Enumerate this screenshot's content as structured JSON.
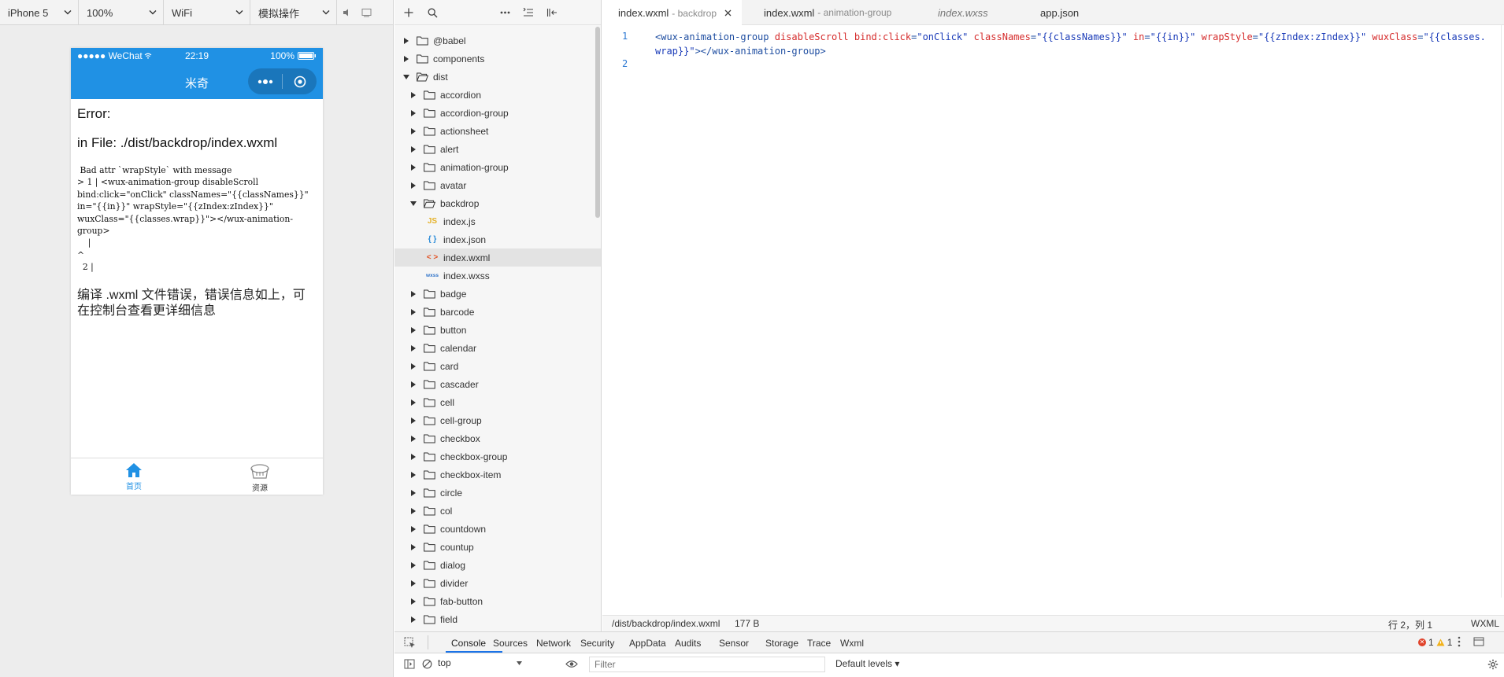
{
  "simulator": {
    "toolbar": {
      "device": "iPhone 5",
      "zoom": "100%",
      "network": "WiFi",
      "operation": "模拟操作"
    },
    "status_bar": {
      "carrier": "●●●●● WeChat",
      "time": "22:19",
      "battery": "100%"
    },
    "nav_title": "米奇",
    "error": {
      "title": "Error:",
      "file": "in File: ./dist/backdrop/index.wxml",
      "message": " Bad attr `wrapStyle` with message\n> 1 | <wux-animation-group disableScroll bind:click=\"onClick\" classNames=\"{{classNames}}\" in=\"{{in}}\" wrapStyle=\"{{zIndex:zIndex}}\" wuxClass=\"{{classes.wrap}}\"></wux-animation-group>\n    |\n^\n  2 |",
      "hint": "编译 .wxml 文件错误，错误信息如上，可在控制台查看更详细信息"
    },
    "tabbar": {
      "items": [
        {
          "label": "首页",
          "icon": "home-icon"
        },
        {
          "label": "资源",
          "icon": "basket-icon"
        }
      ]
    }
  },
  "file_tree": {
    "rows": [
      {
        "label": "@babel",
        "type": "folder",
        "expanded": false,
        "level": 0
      },
      {
        "label": "components",
        "type": "folder",
        "expanded": false,
        "level": 0
      },
      {
        "label": "dist",
        "type": "folder",
        "expanded": true,
        "level": 0
      },
      {
        "label": "accordion",
        "type": "folder",
        "expanded": false,
        "level": 1
      },
      {
        "label": "accordion-group",
        "type": "folder",
        "expanded": false,
        "level": 1
      },
      {
        "label": "actionsheet",
        "type": "folder",
        "expanded": false,
        "level": 1
      },
      {
        "label": "alert",
        "type": "folder",
        "expanded": false,
        "level": 1
      },
      {
        "label": "animation-group",
        "type": "folder",
        "expanded": false,
        "level": 1
      },
      {
        "label": "avatar",
        "type": "folder",
        "expanded": false,
        "level": 1
      },
      {
        "label": "backdrop",
        "type": "folder",
        "expanded": true,
        "level": 1
      },
      {
        "label": "index.js",
        "type": "js",
        "level": 2
      },
      {
        "label": "index.json",
        "type": "json",
        "level": 2
      },
      {
        "label": "index.wxml",
        "type": "wxml",
        "level": 2,
        "selected": true
      },
      {
        "label": "index.wxss",
        "type": "wxss",
        "level": 2
      },
      {
        "label": "badge",
        "type": "folder",
        "expanded": false,
        "level": 1
      },
      {
        "label": "barcode",
        "type": "folder",
        "expanded": false,
        "level": 1
      },
      {
        "label": "button",
        "type": "folder",
        "expanded": false,
        "level": 1
      },
      {
        "label": "calendar",
        "type": "folder",
        "expanded": false,
        "level": 1
      },
      {
        "label": "card",
        "type": "folder",
        "expanded": false,
        "level": 1
      },
      {
        "label": "cascader",
        "type": "folder",
        "expanded": false,
        "level": 1
      },
      {
        "label": "cell",
        "type": "folder",
        "expanded": false,
        "level": 1
      },
      {
        "label": "cell-group",
        "type": "folder",
        "expanded": false,
        "level": 1
      },
      {
        "label": "checkbox",
        "type": "folder",
        "expanded": false,
        "level": 1
      },
      {
        "label": "checkbox-group",
        "type": "folder",
        "expanded": false,
        "level": 1
      },
      {
        "label": "checkbox-item",
        "type": "folder",
        "expanded": false,
        "level": 1
      },
      {
        "label": "circle",
        "type": "folder",
        "expanded": false,
        "level": 1
      },
      {
        "label": "col",
        "type": "folder",
        "expanded": false,
        "level": 1
      },
      {
        "label": "countdown",
        "type": "folder",
        "expanded": false,
        "level": 1
      },
      {
        "label": "countup",
        "type": "folder",
        "expanded": false,
        "level": 1
      },
      {
        "label": "dialog",
        "type": "folder",
        "expanded": false,
        "level": 1
      },
      {
        "label": "divider",
        "type": "folder",
        "expanded": false,
        "level": 1
      },
      {
        "label": "fab-button",
        "type": "folder",
        "expanded": false,
        "level": 1
      },
      {
        "label": "field",
        "type": "folder",
        "expanded": false,
        "level": 1
      }
    ],
    "file_icon_text": {
      "js": "JS",
      "json": "{ }",
      "wxml": "< >",
      "wxss": "wxss"
    }
  },
  "editor": {
    "tabs": [
      {
        "name": "index.wxml",
        "sub": "- backdrop",
        "active": true,
        "closable": true
      },
      {
        "name": "index.wxml",
        "sub": "- animation-group",
        "active": false
      },
      {
        "name": "index.wxss",
        "sub": "",
        "active": false,
        "italic": true
      },
      {
        "name": "app.json",
        "sub": "",
        "active": false
      }
    ],
    "lines": [
      {
        "number": "1",
        "tokens": [
          {
            "t": "<wux-animation-group ",
            "c": "tag"
          },
          {
            "t": "disableScroll ",
            "c": "attr"
          },
          {
            "t": "bind:click",
            "c": "attr"
          },
          {
            "t": "=",
            "c": "tag"
          },
          {
            "t": "\"onClick\" ",
            "c": "str"
          },
          {
            "t": "classNames",
            "c": "attr"
          },
          {
            "t": "=",
            "c": "tag"
          },
          {
            "t": "\"{{classNames}}\" ",
            "c": "str"
          },
          {
            "t": "in",
            "c": "attr"
          },
          {
            "t": "=",
            "c": "tag"
          },
          {
            "t": "\"{{in}}\" ",
            "c": "str"
          },
          {
            "t": "wrapStyle",
            "c": "attr"
          },
          {
            "t": "=",
            "c": "tag"
          },
          {
            "t": "\"{{zIndex:zIndex}}\" ",
            "c": "str"
          },
          {
            "t": "wuxClass",
            "c": "attr"
          },
          {
            "t": "=",
            "c": "tag"
          },
          {
            "t": "\"{{classes.wrap}}\"",
            "c": "str"
          },
          {
            "t": "></wux-animation-group>",
            "c": "tag"
          }
        ]
      },
      {
        "number": "2",
        "tokens": []
      }
    ],
    "status": {
      "path": "/dist/backdrop/index.wxml",
      "size": "177 B",
      "position": "行 2，列 1",
      "language": "WXML"
    }
  },
  "devtools": {
    "tabs": [
      "Console",
      "Sources",
      "Network",
      "Security",
      "AppData",
      "Audits",
      "Sensor",
      "Storage",
      "Trace",
      "Wxml"
    ],
    "active_tab": "Console",
    "error_count": "1",
    "warning_count": "1",
    "context": "top",
    "filter_placeholder": "Filter",
    "levels": "Default levels ▾"
  },
  "colors": {
    "wechat_blue": "#2091e4",
    "selection": "#e3e3e3",
    "accent": "#1a73e8"
  }
}
